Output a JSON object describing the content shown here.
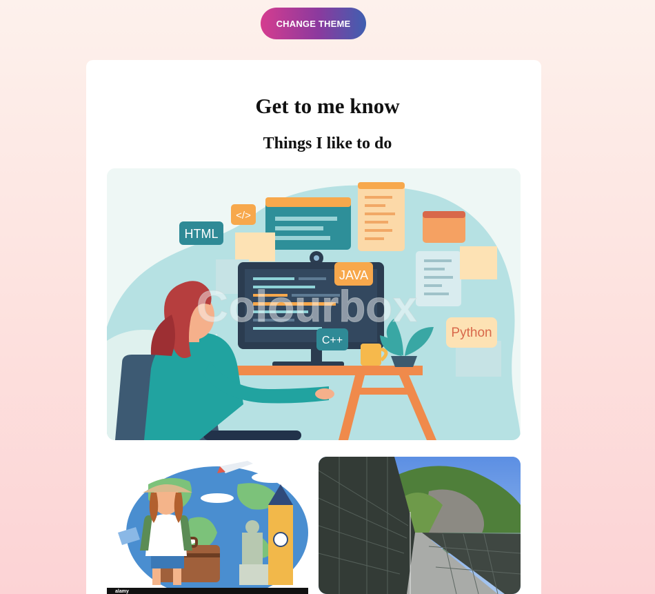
{
  "header": {
    "theme_button_label": "CHANGE THEME"
  },
  "card": {
    "title": "Get to me know",
    "subtitle": "Things I like to do"
  },
  "images": {
    "coding": {
      "tags": [
        "HTML",
        "</>",
        "JAVA",
        "C++",
        "Python"
      ],
      "watermark": "Colourbox"
    },
    "travel": {
      "watermark": "alamy"
    },
    "bridge": {}
  },
  "colors": {
    "button_gradient_start": "#d53c8f",
    "button_gradient_end": "#3f5fb0",
    "page_background": "#fde1de",
    "card_background": "#ffffff"
  }
}
